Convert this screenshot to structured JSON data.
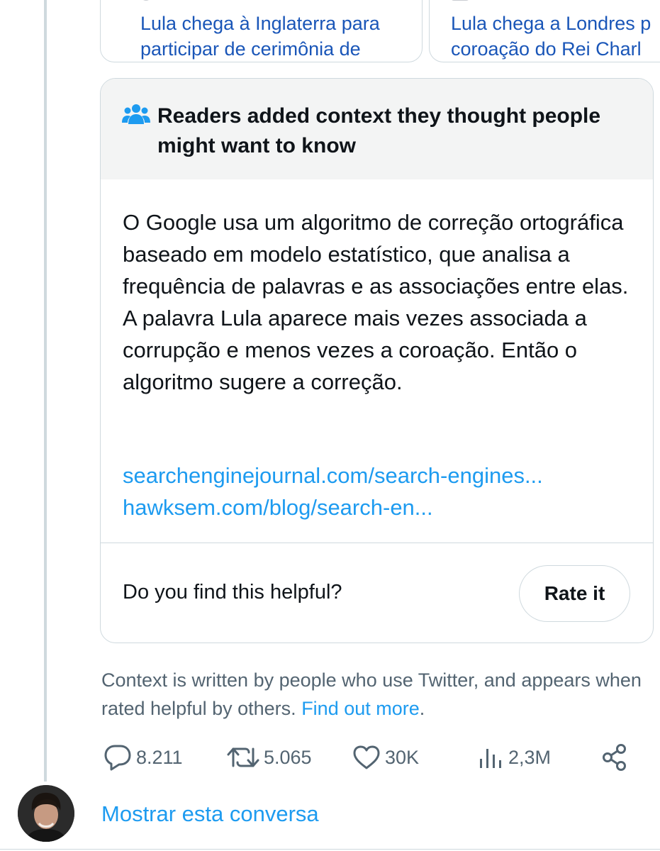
{
  "news_cards": [
    {
      "title_line1": "Lula chega à Inglaterra para",
      "title_line2": "participar de cerimônia de"
    },
    {
      "title_line1": "Lula chega a Londres p",
      "title_line2": "coroação do Rei Charl"
    }
  ],
  "note": {
    "icon": "people-icon",
    "title": "Readers added context they thought people might want to know",
    "body": "O Google usa um algoritmo de correção ortográfica baseado em modelo estatístico, que analisa a frequência de palavras e as associações entre elas. A palavra Lula aparece mais vezes associada a corrupção e menos vezes a coroação. Então o algoritmo sugere a correção.",
    "links": [
      "searchenginejournal.com/search-engines...",
      "hawksem.com/blog/search-en..."
    ],
    "helpful_question": "Do you find this helpful?",
    "rate_button": "Rate it"
  },
  "disclaimer": {
    "text": "Context is written by people who use Twitter, and appears when rated helpful by others.",
    "link": "Find out more",
    "trailing": "."
  },
  "actions": {
    "replies": "8.211",
    "retweets": "5.065",
    "likes": "30K",
    "views": "2,3M"
  },
  "show_conversation": "Mostrar esta conversa",
  "colors": {
    "accent": "#1d9bf0",
    "text": "#0f1419",
    "secondary": "#536471",
    "border": "#cfd9de"
  }
}
